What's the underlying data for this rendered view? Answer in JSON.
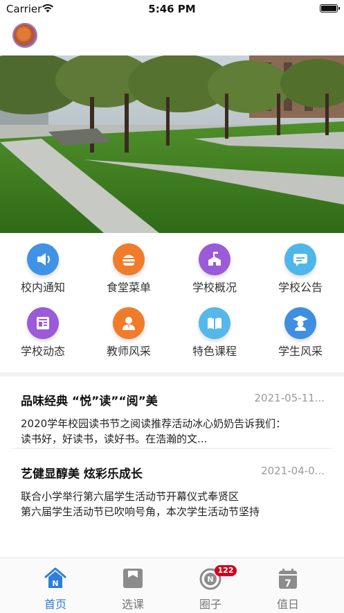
{
  "status_bar": {
    "carrier": "Carrier",
    "time": "5:46 PM"
  },
  "menu": [
    {
      "label": "校内通知",
      "icon": "speaker-icon",
      "color": "#3f92e6"
    },
    {
      "label": "食堂菜单",
      "icon": "burger-icon",
      "color": "#f07c2b"
    },
    {
      "label": "学校概况",
      "icon": "school-building-icon",
      "color": "#9b5bd8"
    },
    {
      "label": "学校公告",
      "icon": "chat-bubble-icon",
      "color": "#4fb6ea"
    },
    {
      "label": "学校动态",
      "icon": "news-icon",
      "color": "#9b5bd8"
    },
    {
      "label": "教师风采",
      "icon": "teacher-icon",
      "color": "#f07c2b"
    },
    {
      "label": "特色课程",
      "icon": "book-icon",
      "color": "#56b8ea"
    },
    {
      "label": "学生风采",
      "icon": "graduate-icon",
      "color": "#3f8fe0"
    }
  ],
  "news": [
    {
      "title": "品味经典 “悦”读”“阅”美",
      "date": "2021-05-11...",
      "summary": "2020学年校园读书节之阅读推荐活动冰心奶奶告诉我们：\n读书好，好读书，读好书。在浩瀚的文..."
    },
    {
      "title": "艺健显醇美 炫彩乐成长",
      "date": "2021-04-0...",
      "summary": " 联合小学举行第六届学生活动节开幕仪式奉贤区\n第六届学生活动节已吹响号角，本次学生活动节坚持"
    }
  ],
  "tabbar": {
    "items": [
      {
        "label": "首页",
        "icon": "home-icon",
        "active": true
      },
      {
        "label": "选课",
        "icon": "course-icon",
        "active": false
      },
      {
        "label": "圈子",
        "icon": "circle-icon",
        "active": false,
        "badge": "122"
      },
      {
        "label": "值日",
        "icon": "calendar-icon",
        "active": false,
        "icon_text": "7"
      }
    ]
  },
  "colors": {
    "accent": "#2f7ed8",
    "badge": "#d0021b",
    "inactive": "#777777"
  }
}
